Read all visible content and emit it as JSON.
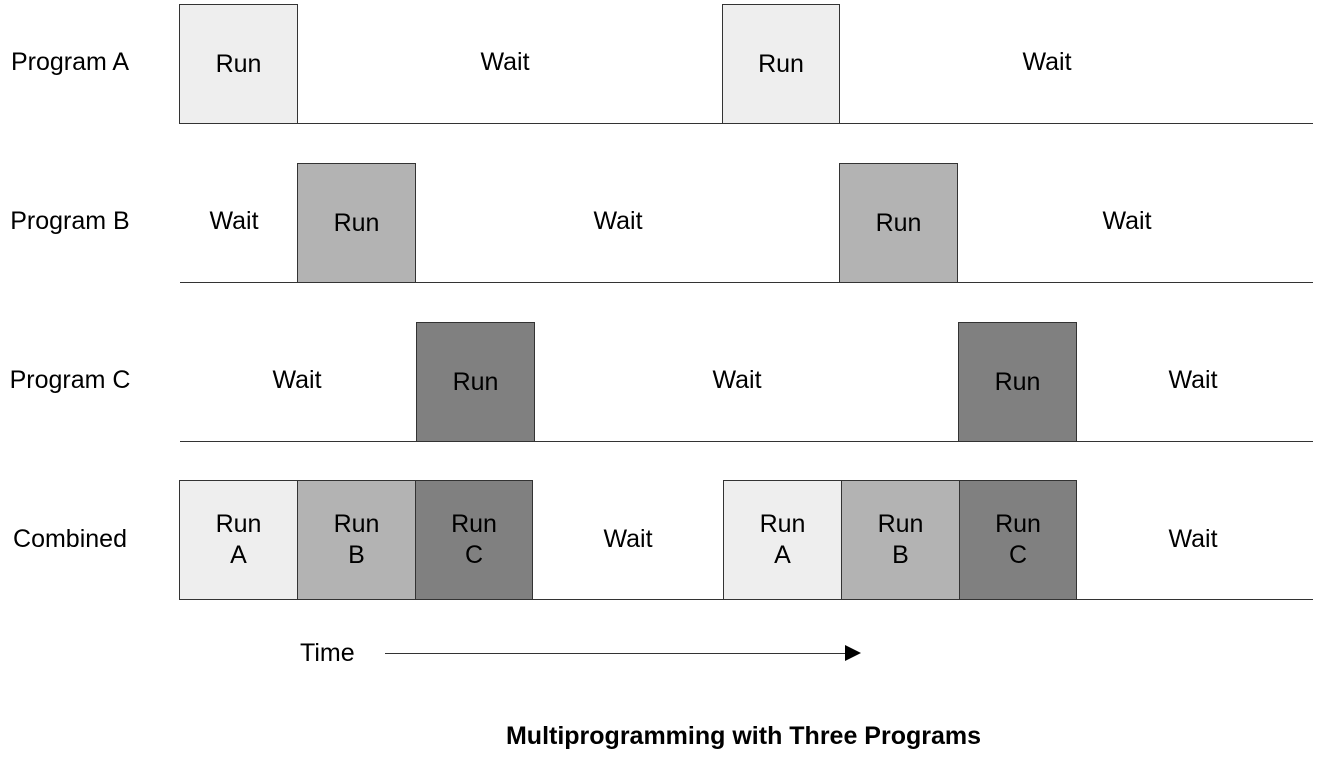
{
  "title": "Multiprogramming with Three Programs",
  "time_label": "Time",
  "colors": {
    "program_a": "#eeeeee",
    "program_b": "#b3b3b3",
    "program_c": "#808080",
    "border": "#333333"
  },
  "rows": [
    {
      "label": "Program A",
      "segments": [
        "Run",
        "Wait",
        "Run",
        "Wait"
      ]
    },
    {
      "label": "Program B",
      "segments": [
        "Wait",
        "Run",
        "Wait",
        "Run",
        "Wait"
      ]
    },
    {
      "label": "Program C",
      "segments": [
        "Wait",
        "Run",
        "Wait",
        "Run",
        "Wait"
      ]
    },
    {
      "label": "Combined",
      "segments": [
        "Run\nA",
        "Run\nB",
        "Run\nC",
        "Wait",
        "Run\nA",
        "Run\nB",
        "Run\nC",
        "Wait"
      ]
    }
  ]
}
